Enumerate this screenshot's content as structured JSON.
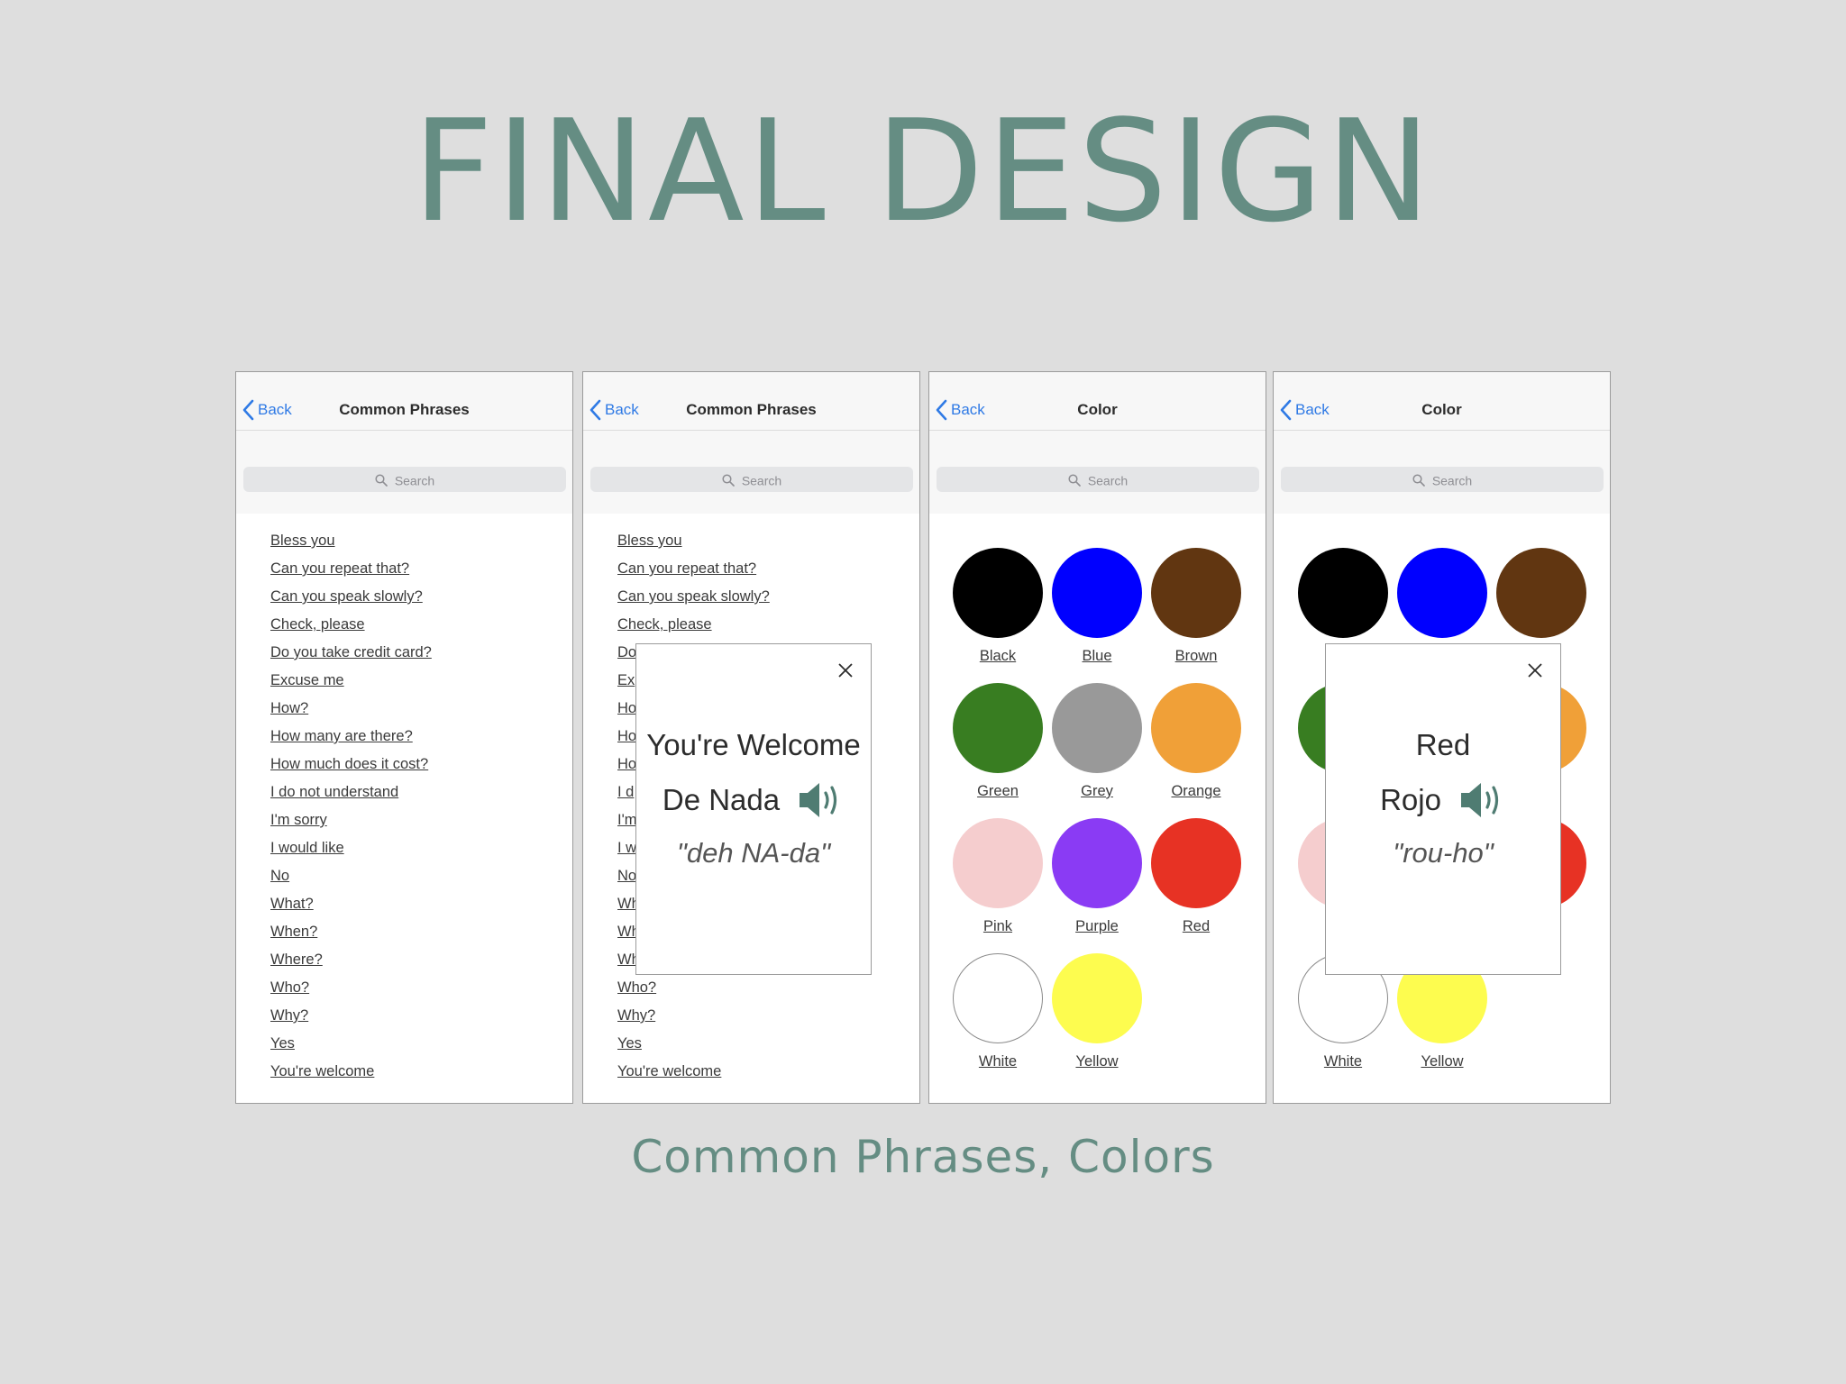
{
  "main_title": "FINAL DESIGN",
  "caption": "Common Phrases, Colors",
  "common": {
    "back_label": "Back",
    "search_placeholder": "Search"
  },
  "screens": [
    {
      "title": "Common Phrases"
    },
    {
      "title": "Common Phrases"
    },
    {
      "title": "Color"
    },
    {
      "title": "Color"
    }
  ],
  "phrases": [
    "Bless you",
    "Can you repeat that?",
    "Can you speak slowly?",
    "Check, please",
    "Do you take credit card?",
    "Excuse me",
    "How?",
    "How many are there?",
    "How much does it cost?",
    "I do not understand",
    "I'm sorry",
    "I would like",
    "No",
    "What?",
    "When?",
    "Where?",
    "Who?",
    "Why?",
    "Yes",
    "You're welcome"
  ],
  "phrases_partial": [
    "Bless you",
    "Can you repeat that?",
    "Can you speak slowly?",
    "Check, please",
    "Do",
    "Ex",
    "Ho",
    "Ho",
    "Ho",
    "I d",
    "I'm",
    "I w",
    "No",
    "Wh",
    "Wh",
    "Wh",
    "Who?",
    "Why?",
    "Yes",
    "You're welcome"
  ],
  "colors": [
    {
      "name": "Black",
      "hex": "#000000"
    },
    {
      "name": "Blue",
      "hex": "#0000ff"
    },
    {
      "name": "Brown",
      "hex": "#613611"
    },
    {
      "name": "Green",
      "hex": "#387d21"
    },
    {
      "name": "Grey",
      "hex": "#999999"
    },
    {
      "name": "Orange",
      "hex": "#f0a038"
    },
    {
      "name": "Pink",
      "hex": "#f5cdce"
    },
    {
      "name": "Purple",
      "hex": "#8a3bf4"
    },
    {
      "name": "Red",
      "hex": "#e73224"
    },
    {
      "name": "White",
      "hex": "#ffffff"
    },
    {
      "name": "Yellow",
      "hex": "#fdfc4f"
    }
  ],
  "colors_partial_labels": [
    "",
    "",
    "n",
    "",
    "",
    "e",
    "",
    "",
    "",
    "White",
    "Yellow"
  ],
  "popup_phrase": {
    "english": "You're Welcome",
    "spanish": "De Nada",
    "pronunciation": "\"deh NA-da\"",
    "speaker_icon": "speaker-icon"
  },
  "popup_color": {
    "english": "Red",
    "spanish": "Rojo",
    "pronunciation": "\"rou-ho\"",
    "speaker_icon": "speaker-icon"
  },
  "theme": {
    "accent": "#658d83",
    "link": "#2f7ae5",
    "background": "#dedede"
  }
}
